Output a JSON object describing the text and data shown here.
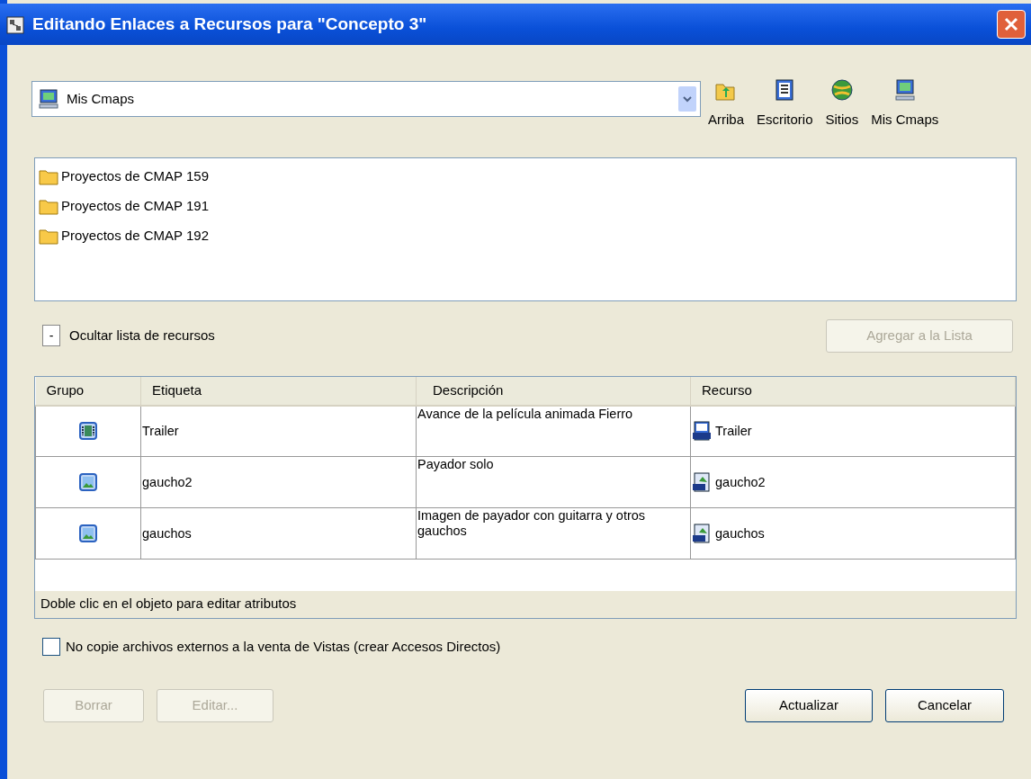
{
  "window": {
    "title": "Editando Enlaces a Recursos para \"Concepto 3\""
  },
  "location": {
    "value": "Mis Cmaps"
  },
  "toolbar": [
    {
      "kind": "up",
      "label": "Arriba"
    },
    {
      "kind": "desktop",
      "label": "Escritorio"
    },
    {
      "kind": "sites",
      "label": "Sitios"
    },
    {
      "kind": "cmaps",
      "label": "Mis Cmaps"
    }
  ],
  "files": [
    {
      "name": "Proyectos de CMAP 159"
    },
    {
      "name": "Proyectos de CMAP 191"
    },
    {
      "name": "Proyectos de CMAP 192"
    }
  ],
  "resource_toggle": {
    "symbol": "-",
    "label": "Ocultar lista de recursos"
  },
  "add_button": {
    "label": "Agregar a la Lista",
    "disabled": true
  },
  "table": {
    "columns": [
      "Grupo",
      "Etiqueta",
      "Descripción",
      "Recurso"
    ],
    "rows": [
      {
        "kind": "video",
        "label": "Trailer",
        "description": "Avance de la película animada Fierro",
        "resource": {
          "kind": "wmv",
          "name": "Trailer"
        }
      },
      {
        "kind": "image",
        "label": "gaucho2",
        "description": "Payador solo",
        "resource": {
          "kind": "jpg",
          "name": "gaucho2"
        }
      },
      {
        "kind": "image",
        "label": "gauchos",
        "description": "Imagen de payador con guitarra y otros gauchos",
        "resource": {
          "kind": "jpg",
          "name": "gauchos"
        }
      }
    ],
    "hint": "Doble clic en el objeto para editar atributos"
  },
  "shortcut_option": {
    "label": "No copie archivos externos a la venta de Vistas (crear Accesos Directos)",
    "checked": false
  },
  "buttons": [
    {
      "label": "Borrar",
      "disabled": true
    },
    {
      "label": "Editar...",
      "disabled": true
    },
    {
      "label": "Actualizar",
      "disabled": false
    },
    {
      "label": "Cancelar",
      "disabled": false
    }
  ]
}
